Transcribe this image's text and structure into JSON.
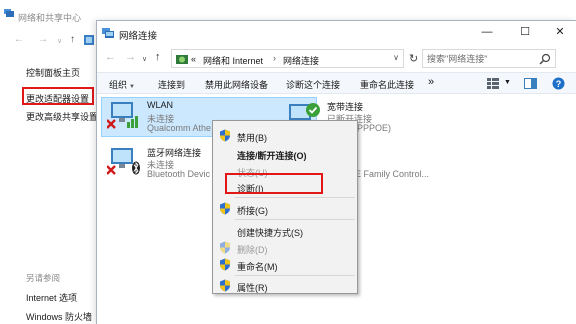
{
  "background_window": {
    "title": "网络和共享中心",
    "sidebar": {
      "control_panel_home": "控制面板主页",
      "change_adapter_settings": "更改适配器设置",
      "change_advanced_sharing": "更改高级共享设置",
      "see_also": "另请参阅",
      "internet_options": "Internet 选项",
      "windows_firewall": "Windows 防火墙"
    }
  },
  "window": {
    "title": "网络连接",
    "minimize": "—",
    "maximize": "☐",
    "close": "✕"
  },
  "address": {
    "back": "←",
    "forward": "→",
    "up": "↑",
    "overflow": "«",
    "crumb_1": "网络和 Internet",
    "crumb_2": "网络连接",
    "separator": "›",
    "dropdown": "∨",
    "refresh": "↻",
    "search_placeholder": "搜索\"网络连接\""
  },
  "toolbar": {
    "organize": "组织",
    "connect_to": "连接到",
    "disable_device": "禁用此网络设备",
    "diagnose_connection": "诊断这个连接",
    "rename_connection": "重命名此连接",
    "more": "»",
    "dropdown_arrow": "▼"
  },
  "connections": [
    {
      "name": "WLAN",
      "status": "未连接",
      "device": "Qualcomm Athe",
      "icon": "wireless-adapter-icon",
      "state": "disconnected"
    },
    {
      "name": "宽带连接",
      "status": "已断开连接",
      "device": "iniport (PPPOE)",
      "icon": "broadband-icon",
      "state": "connected"
    },
    {
      "name": "蓝牙网络连接",
      "status": "未连接",
      "device": "Bluetooth Devic",
      "icon": "bluetooth-adapter-icon",
      "state": "disconnected"
    },
    {
      "name": "",
      "status": "",
      "device": "PCIe FE Family Control...",
      "icon": "ethernet-adapter-icon",
      "state": "unknown"
    }
  ],
  "context_menu": {
    "items": [
      {
        "label": "禁用(B)",
        "shield": true,
        "disabled": false,
        "bold": false
      },
      {
        "label": "连接/断开连接(O)",
        "shield": false,
        "disabled": false,
        "bold": true
      },
      {
        "label": "状态(U)",
        "shield": false,
        "disabled": true,
        "bold": false
      },
      {
        "label": "诊断(I)",
        "shield": false,
        "disabled": false,
        "bold": false
      },
      {
        "label": "桥接(G)",
        "shield": true,
        "disabled": false,
        "bold": false
      },
      {
        "label": "创建快捷方式(S)",
        "shield": false,
        "disabled": false,
        "bold": false
      },
      {
        "label": "删除(D)",
        "shield": true,
        "disabled": true,
        "bold": false
      },
      {
        "label": "重命名(M)",
        "shield": true,
        "disabled": false,
        "bold": false
      },
      {
        "label": "属性(R)",
        "shield": true,
        "disabled": false,
        "bold": false
      }
    ]
  },
  "colors": {
    "highlight_red": "#e01818",
    "selection_blue": "#cce8ff",
    "toolbar_bg": "#f4f7fb"
  }
}
